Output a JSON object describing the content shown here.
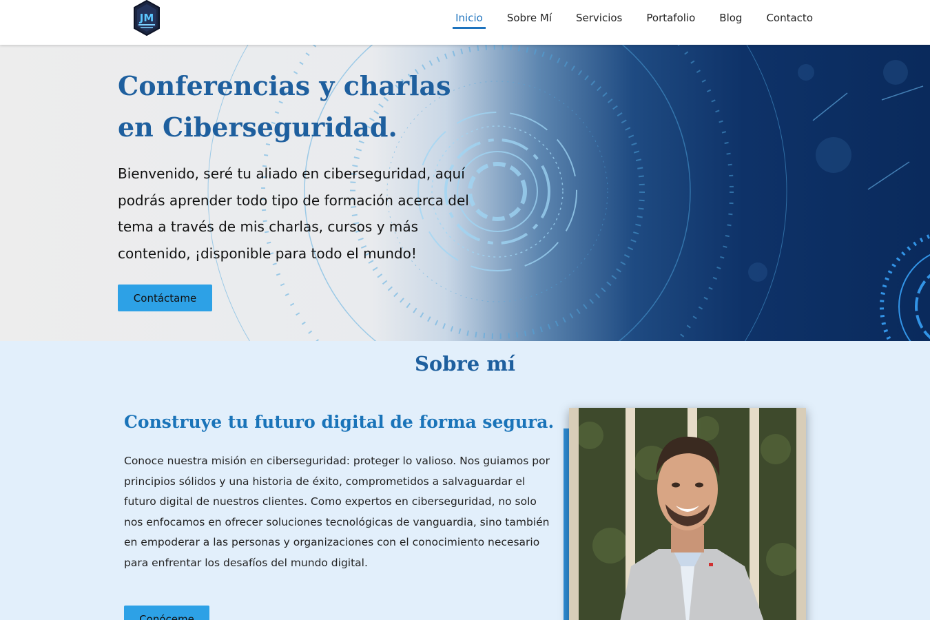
{
  "header": {
    "logo_text": "JM",
    "nav": [
      {
        "label": "Inicio",
        "active": true
      },
      {
        "label": "Sobre Mí",
        "active": false
      },
      {
        "label": "Servicios",
        "active": false
      },
      {
        "label": "Portafolio",
        "active": false
      },
      {
        "label": "Blog",
        "active": false
      },
      {
        "label": "Contacto",
        "active": false
      }
    ]
  },
  "hero": {
    "title_line1": "Conferencias y charlas",
    "title_line2": "en Ciberseguridad.",
    "text": "Bienvenido, seré tu aliado en ciberseguridad, aquí podrás aprender todo tipo de formación acerca del tema a través de mis charlas, cursos y más contenido, ¡disponible para todo el mundo!",
    "button_label": "Contáctame"
  },
  "about": {
    "heading": "Sobre mí",
    "subheading": "Construye tu futuro digital de forma segura.",
    "text": "Conoce nuestra misión en ciberseguridad: proteger lo valioso. Nos guiamos por principios sólidos y una historia de éxito, comprometidos a salvaguardar el futuro digital de nuestros clientes. Como expertos en ciberseguridad, no solo nos enfocamos en ofrecer soluciones tecnológicas de vanguardia, sino también en empoderar a las personas y organizaciones con el conocimiento necesario para enfrentar los desafíos del mundo digital.",
    "button_label": "Conóceme"
  },
  "colors": {
    "accent": "#1e73be",
    "button": "#2da1e6",
    "heading": "#1e5f9e",
    "about_bg": "#e2effb"
  }
}
